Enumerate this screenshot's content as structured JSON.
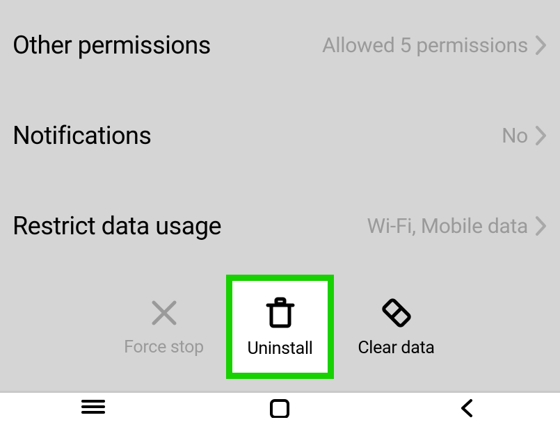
{
  "settings": [
    {
      "label": "Other permissions",
      "value": "Allowed 5 permissions"
    },
    {
      "label": "Notifications",
      "value": "No"
    },
    {
      "label": "Restrict data usage",
      "value": "Wi-Fi, Mobile data"
    }
  ],
  "actions": {
    "force_stop": "Force stop",
    "uninstall": "Uninstall",
    "clear_data": "Clear data"
  },
  "highlight": {
    "color": "#18d100",
    "target": "uninstall"
  }
}
